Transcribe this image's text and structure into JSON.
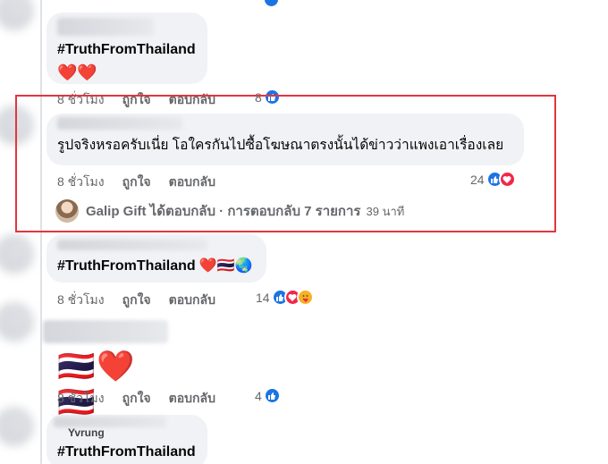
{
  "actions": {
    "time": "8 ชั่วโมง",
    "like": "ถูกใจ",
    "reply": "ตอบกลับ"
  },
  "comments": [
    {
      "text": "#TruthFromThailand",
      "emoji": "❤️❤️",
      "reaction_count": "8"
    },
    {
      "text": "รูปจริงหรอครับเนี่ย โอใครกันไปซื้อโฆษณาตรงนั้นได้ข่าวว่าแพงเอาเรื่องเลย",
      "reaction_count": "24",
      "replies": {
        "summary": "Galip Gift ได้ตอบกลับ · การตอบกลับ 7 รายการ",
        "time": "39 นาที"
      }
    },
    {
      "text": "#TruthFromThailand",
      "emoji": "❤️🇹🇭🌏",
      "reaction_count": "14"
    },
    {
      "emoji": "🇹🇭❤️🇹🇭",
      "reaction_count": "4"
    },
    {
      "partial_name": "Yvrung",
      "text": "#TruthFromThailand"
    }
  ],
  "colors": {
    "highlight": "#e2363f",
    "like": "#1b74e4",
    "love": "#f0284a",
    "care": "#f7b125"
  }
}
